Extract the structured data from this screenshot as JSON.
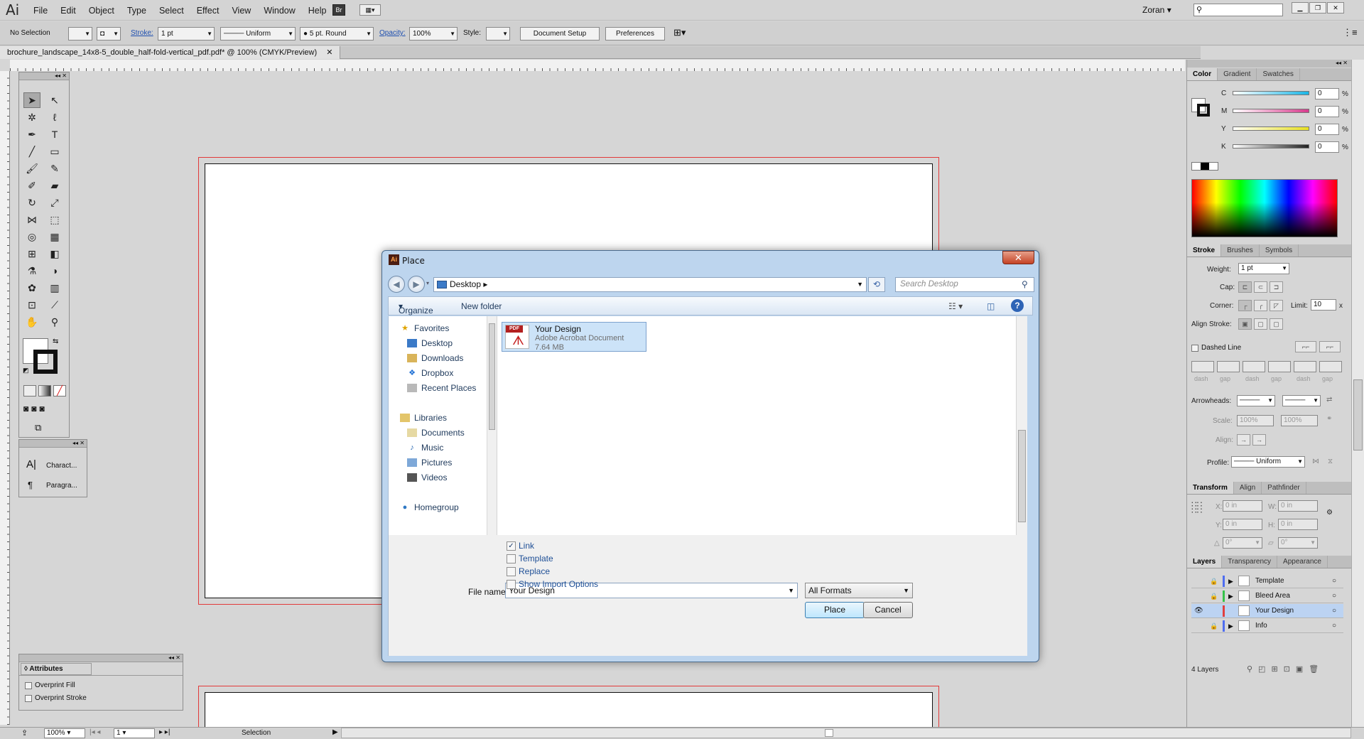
{
  "app": {
    "logo": "Ai",
    "menu": [
      "File",
      "Edit",
      "Object",
      "Type",
      "Select",
      "Effect",
      "View",
      "Window",
      "Help"
    ],
    "bridge_btn": "Br",
    "user": "Zoran"
  },
  "control": {
    "selection": "No Selection",
    "stroke_label": "Stroke:",
    "stroke_weight": "1 pt",
    "profile": "Uniform",
    "brush": "5 pt. Round",
    "opacity_label": "Opacity:",
    "opacity": "100%",
    "style_label": "Style:",
    "doc_setup": "Document Setup",
    "preferences": "Preferences"
  },
  "document_tab": "brochure_landscape_14x8-5_double_half-fold-vertical_pdf.pdf* @ 100% (CMYK/Preview)",
  "char_panel": {
    "character": "Charact...",
    "paragraph": "Paragra..."
  },
  "attributes": {
    "title": "Attributes",
    "overprint_fill": "Overprint Fill",
    "overprint_stroke": "Overprint Stroke"
  },
  "color_panel": {
    "tabs": [
      "Color",
      "Gradient",
      "Swatches"
    ],
    "channels": [
      {
        "label": "C",
        "value": "0",
        "color": "#19b5e6"
      },
      {
        "label": "M",
        "value": "0",
        "color": "#d63a8c"
      },
      {
        "label": "Y",
        "value": "0",
        "color": "#e8e021"
      },
      {
        "label": "K",
        "value": "0",
        "color": "#222222"
      }
    ],
    "pct": "%"
  },
  "stroke_panel": {
    "tabs": [
      "Stroke",
      "Brushes",
      "Symbols"
    ],
    "weight_label": "Weight:",
    "weight": "1 pt",
    "cap_label": "Cap:",
    "corner_label": "Corner:",
    "limit_label": "Limit:",
    "limit": "10",
    "limit_x": "x",
    "align_label": "Align Stroke:",
    "dashed": "Dashed Line",
    "dash_labels": [
      "dash",
      "gap",
      "dash",
      "gap",
      "dash",
      "gap"
    ],
    "arrowheads_label": "Arrowheads:",
    "scale_label": "Scale:",
    "scale1": "100%",
    "scale2": "100%",
    "align2_label": "Align:",
    "profile_label": "Profile:",
    "profile": "Uniform"
  },
  "transform_panel": {
    "tabs": [
      "Transform",
      "Align",
      "Pathfinder"
    ],
    "x_label": "X:",
    "x": "0 in",
    "w_label": "W:",
    "w": "0 in",
    "y_label": "Y:",
    "y": "0 in",
    "h_label": "H:",
    "h": "0 in",
    "angle": "0°",
    "shear": "0°"
  },
  "layers_panel": {
    "tabs": [
      "Layers",
      "Transparency",
      "Appearance"
    ],
    "layers": [
      {
        "name": "Template",
        "color": "#4f6df0"
      },
      {
        "name": "Bleed Area",
        "color": "#35c24a"
      },
      {
        "name": "Your Design",
        "color": "#e04040"
      },
      {
        "name": "Info",
        "color": "#4f6df0"
      }
    ],
    "count": "4 Layers"
  },
  "status": {
    "zoom": "100%",
    "page": "1",
    "tool": "Selection"
  },
  "dialog": {
    "title": "Place",
    "close": "✕",
    "location": "Desktop",
    "search_placeholder": "Search Desktop",
    "organize": "Organize",
    "new_folder": "New folder",
    "nav": {
      "favorites": "Favorites",
      "favorites_items": [
        "Desktop",
        "Downloads",
        "Dropbox",
        "Recent Places"
      ],
      "libraries": "Libraries",
      "libraries_items": [
        "Documents",
        "Music",
        "Pictures",
        "Videos"
      ],
      "homegroup": "Homegroup"
    },
    "file": {
      "name": "Your Design",
      "type": "Adobe Acrobat Document",
      "size": "7.64 MB",
      "badge": "PDF"
    },
    "options": [
      {
        "label": "Link",
        "checked": true
      },
      {
        "label": "Template",
        "checked": false
      },
      {
        "label": "Replace",
        "checked": false
      },
      {
        "label": "Show Import Options",
        "checked": false
      }
    ],
    "filename_label": "File name:",
    "filename": "Your Design",
    "filter": "All Formats",
    "place": "Place",
    "cancel": "Cancel"
  }
}
